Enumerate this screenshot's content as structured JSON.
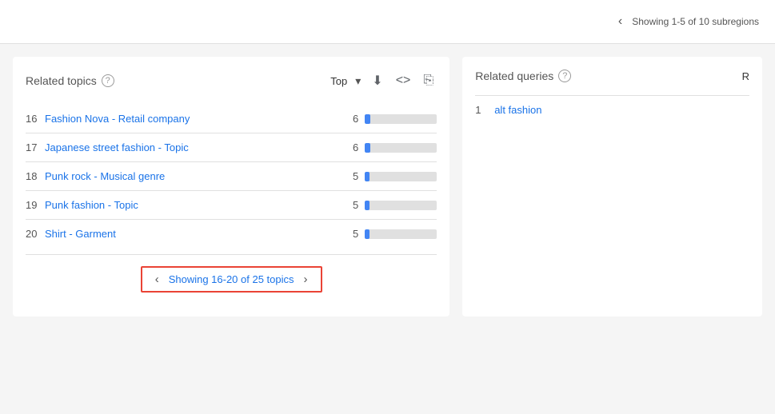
{
  "topBar": {
    "pagination_text": "Showing 1-5 of 10 subregions",
    "chevron_left": "‹",
    "chevron_right": "›"
  },
  "relatedTopics": {
    "title": "Related topics",
    "filter_label": "Top",
    "topics": [
      {
        "num": "16",
        "label": "Fashion Nova - Retail company",
        "value": "6",
        "bar_pct": 7
      },
      {
        "num": "17",
        "label": "Japanese street fashion - Topic",
        "value": "6",
        "bar_pct": 7
      },
      {
        "num": "18",
        "label": "Punk rock - Musical genre",
        "value": "5",
        "bar_pct": 6
      },
      {
        "num": "19",
        "label": "Punk fashion - Topic",
        "value": "5",
        "bar_pct": 6
      },
      {
        "num": "20",
        "label": "Shirt - Garment",
        "value": "5",
        "bar_pct": 6
      }
    ],
    "pagination": {
      "showing": "Showing 16-20 of 25 topics"
    }
  },
  "relatedQueries": {
    "title": "Related queries",
    "filter_label": "R",
    "queries": [
      {
        "num": "1",
        "label": "alt fashion"
      }
    ]
  },
  "icons": {
    "help": "?",
    "download": "⬇",
    "code": "<>",
    "share": "⎘",
    "dropdown": "▾"
  }
}
